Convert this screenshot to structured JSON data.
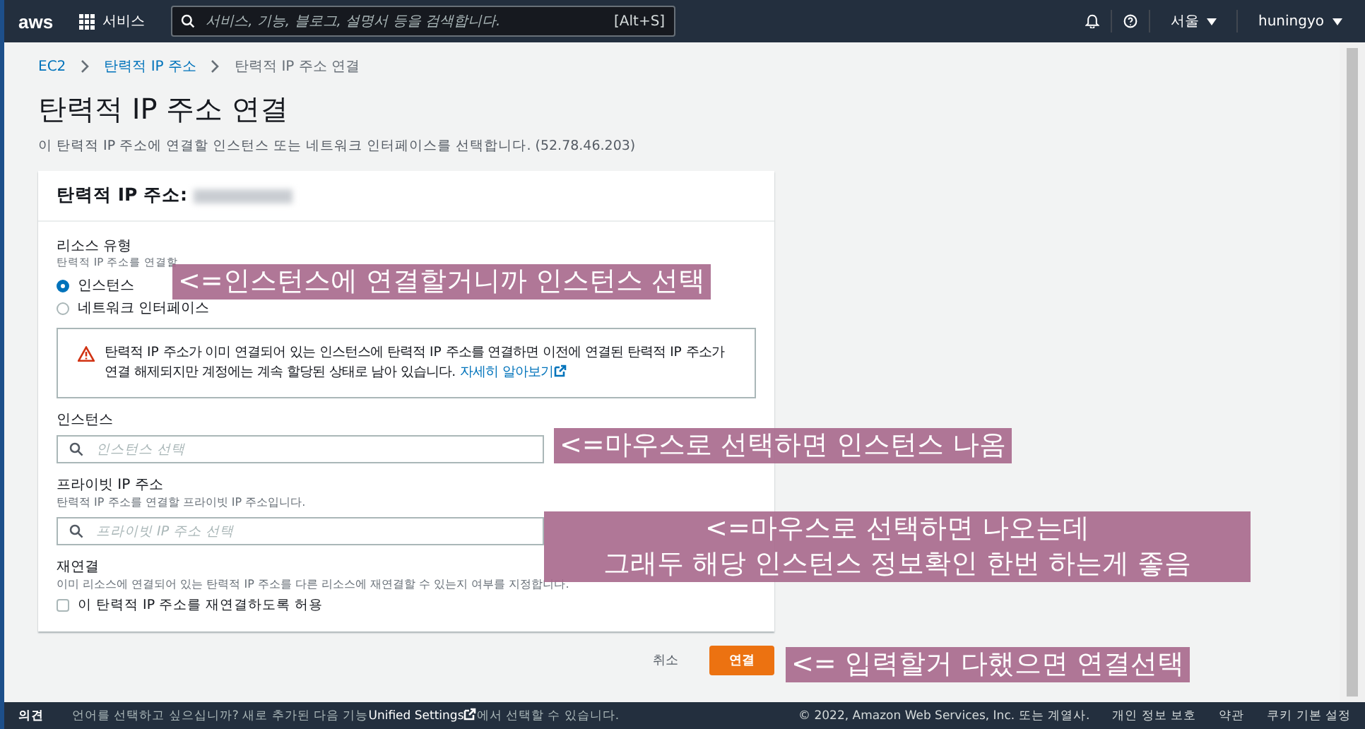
{
  "top_nav": {
    "logo": "aws",
    "services": "서비스",
    "search_placeholder": "서비스, 기능, 블로그, 설명서 등을 검색합니다.",
    "search_shortcut": "[Alt+S]",
    "region": "서울",
    "user": "huningyo"
  },
  "breadcrumbs": [
    {
      "label": "EC2",
      "link": true
    },
    {
      "label": "탄력적 IP 주소",
      "link": true
    },
    {
      "label": "탄력적 IP 주소 연결",
      "link": false
    }
  ],
  "title": "탄력적 IP 주소 연결",
  "description": "이 탄력적 IP 주소에 연결할 인스턴스 또는 네트워크 인터페이스를 선택합니다. (52.78.46.203)",
  "card": {
    "header": "탄력적 IP 주소:",
    "resource_type": {
      "label": "리소스 유형",
      "hint": "탄력적 IP 주소를 연결할",
      "options": [
        {
          "label": "인스턴스",
          "selected": true
        },
        {
          "label": "네트워크 인터페이스",
          "selected": false
        }
      ]
    },
    "warning": {
      "text": "탄력적 IP 주소가 이미 연결되어 있는 인스턴스에 탄력적 IP 주소를 연결하면 이전에 연결된 탄력적 IP 주소가 연결 해제되지만 계정에는 계속 할당된 상태로 남아 있습니다.",
      "link": "자세히 알아보기"
    },
    "instance": {
      "label": "인스턴스",
      "placeholder": "인스턴스 선택"
    },
    "private_ip": {
      "label": "프라이빗 IP 주소",
      "hint": "탄력적 IP 주소를 연결할 프라이빗 IP 주소입니다.",
      "placeholder": "프라이빗 IP 주소 선택"
    },
    "reassociation": {
      "label": "재연결",
      "hint": "이미 리소스에 연결되어 있는 탄력적 IP 주소를 다른 리소스에 재연결할 수 있는지 여부를 지정합니다.",
      "checkbox": "이 탄력적 IP 주소를 재연결하도록 허용",
      "checked": false
    }
  },
  "actions": {
    "cancel": "취소",
    "submit": "연결"
  },
  "annotations": [
    {
      "lines": [
        "<=인스턴스에 연결할거니까 인스턴스 선택"
      ]
    },
    {
      "lines": [
        "<=마우스로 선택하면 인스턴스 나옴"
      ]
    },
    {
      "lines": [
        "<=마우스로 선택하면 나오는데",
        "그래두 해당 인스턴스 정보확인 한번 하는게 좋음"
      ]
    },
    {
      "lines": [
        "<= 입력할거 다했으면 연결선택"
      ]
    }
  ],
  "footer": {
    "feedback": "의견",
    "language_prefix": "언어를 선택하고 싶으십니까? 새로 추가된 다음 기능",
    "language_link": "Unified Settings",
    "language_suffix": "에서 선택할 수 있습니다.",
    "copyright": "© 2022, Amazon Web Services, Inc. 또는 계열사.",
    "links": [
      "개인 정보 보호",
      "약관",
      "쿠키 기본 설정"
    ]
  }
}
